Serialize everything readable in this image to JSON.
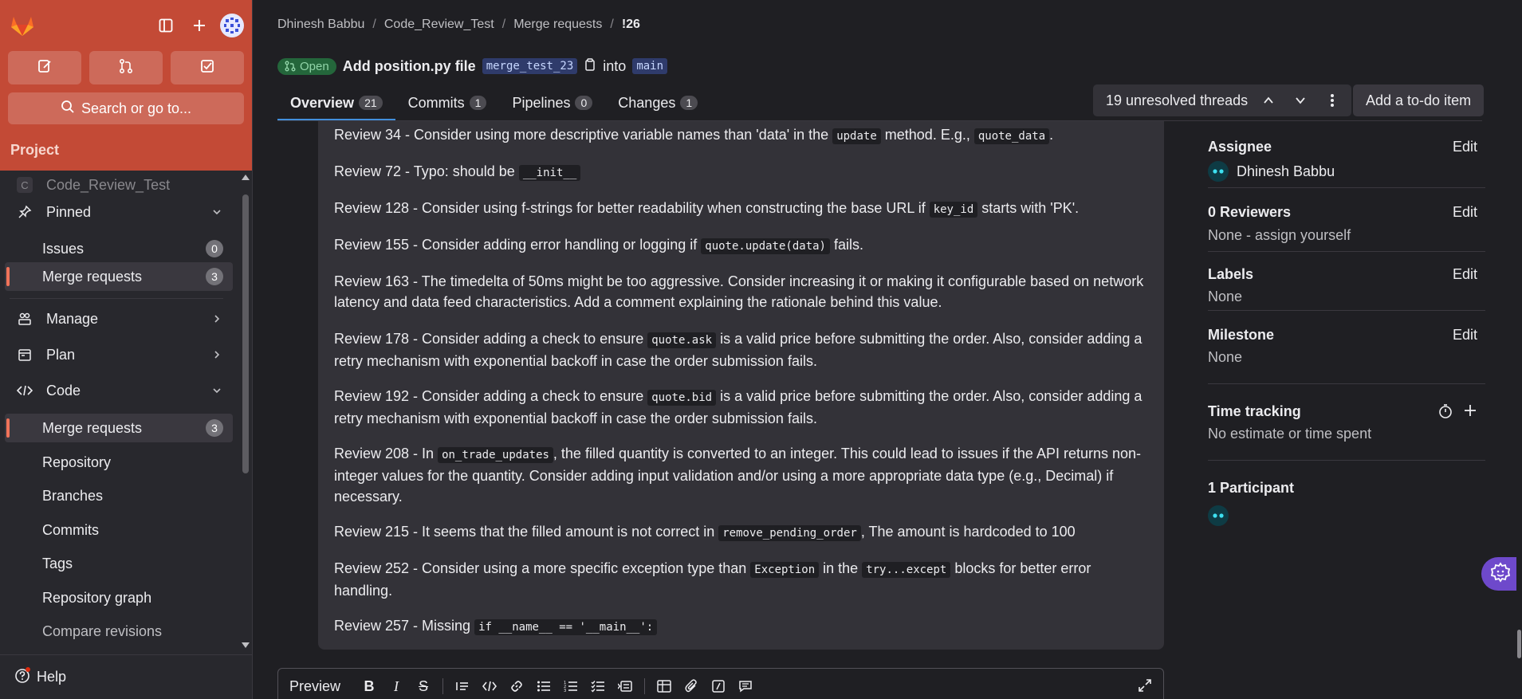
{
  "sidebar": {
    "search_label": "Search or go to...",
    "project_heading": "Project",
    "project_name": "Code_Review_Test",
    "project_initial": "C",
    "items": {
      "pinned": "Pinned",
      "pinned_issues": "Issues",
      "pinned_issues_count": "0",
      "pinned_mr": "Merge requests",
      "pinned_mr_count": "3",
      "manage": "Manage",
      "plan": "Plan",
      "code": "Code",
      "code_mr": "Merge requests",
      "code_mr_count": "3",
      "repository": "Repository",
      "branches": "Branches",
      "commits": "Commits",
      "tags": "Tags",
      "repo_graph": "Repository graph",
      "compare": "Compare revisions"
    },
    "help_label": "Help"
  },
  "breadcrumb": [
    "Dhinesh Babbu",
    "Code_Review_Test",
    "Merge requests",
    "!26"
  ],
  "mr": {
    "status": "Open",
    "title": "Add position.py file",
    "source_branch": "merge_test_23",
    "into_label": "into",
    "target_branch": "main"
  },
  "tabs": [
    {
      "label": "Overview",
      "count": "21"
    },
    {
      "label": "Commits",
      "count": "1"
    },
    {
      "label": "Pipelines",
      "count": "0"
    },
    {
      "label": "Changes",
      "count": "1"
    }
  ],
  "threads_label": "19 unresolved threads",
  "todo_label": "Add a to-do item",
  "reviews": {
    "r34": {
      "a": "Review 34 - Consider using more descriptive variable names than 'data' in the ",
      "c1": "update",
      "b": " method. E.g., ",
      "c2": "quote_data",
      "d": "."
    },
    "r72": {
      "a": "Review 72 - Typo: should be ",
      "c1": "__init__"
    },
    "r128": {
      "a": "Review 128 - Consider using f-strings for better readability when constructing the base URL if ",
      "c1": "key_id",
      "b": " starts with 'PK'."
    },
    "r155": {
      "a": "Review 155 - Consider adding error handling or logging if ",
      "c1": "quote.update(data)",
      "b": " fails."
    },
    "r163": {
      "a": "Review 163 - The timedelta of 50ms might be too aggressive. Consider increasing it or making it configurable based on network latency and data feed characteristics. Add a comment explaining the rationale behind this value."
    },
    "r178": {
      "a": "Review 178 - Consider adding a check to ensure ",
      "c1": "quote.ask",
      "b": " is a valid price before submitting the order. Also, consider adding a retry mechanism with exponential backoff in case the order submission fails."
    },
    "r192": {
      "a": "Review 192 - Consider adding a check to ensure ",
      "c1": "quote.bid",
      "b": " is a valid price before submitting the order. Also, consider adding a retry mechanism with exponential backoff in case the order submission fails."
    },
    "r208": {
      "a": "Review 208 - In ",
      "c1": "on_trade_updates",
      "b": ", the filled quantity is converted to an integer. This could lead to issues if the API returns non-integer values for the quantity. Consider adding input validation and/or using a more appropriate data type (e.g., Decimal) if necessary."
    },
    "r215": {
      "a": "Review 215 - It seems that the filled amount is not correct in ",
      "c1": "remove_pending_order",
      "b": ", The amount is hardcoded to 100"
    },
    "r252": {
      "a": "Review 252 - Consider using a more specific exception type than ",
      "c1": "Exception",
      "b": " in the ",
      "c2": "try...except",
      "d": " blocks for better error handling."
    },
    "r257": {
      "a": "Review 257 - Missing ",
      "c1": "if __name__ == '__main__':"
    }
  },
  "editor": {
    "preview_label": "Preview"
  },
  "right_sidebar": {
    "assignee_title": "Assignee",
    "assignee_name": "Dhinesh Babbu",
    "reviewers_title": "0 Reviewers",
    "reviewers_value": "None - assign yourself",
    "labels_title": "Labels",
    "labels_value": "None",
    "milestone_title": "Milestone",
    "milestone_value": "None",
    "time_title": "Time tracking",
    "time_value": "No estimate or time spent",
    "participants_title": "1 Participant",
    "edit_label": "Edit"
  },
  "colors": {
    "brand_header": "#c34a36",
    "accent_blue": "#428fdc",
    "open_badge": "#24663b",
    "fab_purple": "#6e49cb"
  },
  "icons": [
    "gitlab-logo-icon",
    "sidebar-toggle-icon",
    "plus-icon",
    "issues-icon",
    "merge-request-icon",
    "todo-icon",
    "search-icon",
    "pin-icon",
    "manage-icon",
    "plan-icon",
    "code-icon",
    "chevron-down-icon",
    "chevron-right-icon",
    "help-icon",
    "copy-icon",
    "chevron-up-icon",
    "more-vertical-icon",
    "stopwatch-icon",
    "settings-icon",
    "expand-icon"
  ]
}
